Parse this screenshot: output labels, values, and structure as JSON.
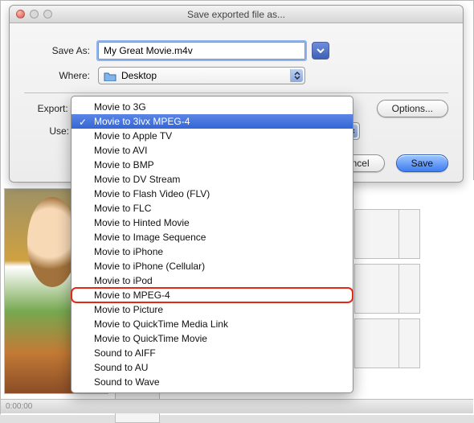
{
  "dialog": {
    "title": "Save exported file as...",
    "saveAsLabel": "Save As:",
    "fileName": "My Great Movie.m4v",
    "whereLabel": "Where:",
    "whereValue": "Desktop",
    "exportLabel": "Export:",
    "useLabel": "Use:",
    "optionsBtn": "Options...",
    "cancelBtn": "Cancel",
    "saveBtn": "Save"
  },
  "exportMenu": {
    "items": [
      "Movie to 3G",
      "Movie to 3ivx MPEG-4",
      "Movie to Apple TV",
      "Movie to AVI",
      "Movie to BMP",
      "Movie to DV Stream",
      "Movie to Flash Video (FLV)",
      "Movie to FLC",
      "Movie to Hinted Movie",
      "Movie to Image Sequence",
      "Movie to iPhone",
      "Movie to iPhone (Cellular)",
      "Movie to iPod",
      "Movie to MPEG-4",
      "Movie to Picture",
      "Movie to QuickTime Media Link",
      "Movie to QuickTime Movie",
      "Sound to AIFF",
      "Sound to AU",
      "Sound to Wave"
    ],
    "selectedIndex": 1,
    "highlightedIndex": 13
  },
  "statusbar": "0:00:00"
}
